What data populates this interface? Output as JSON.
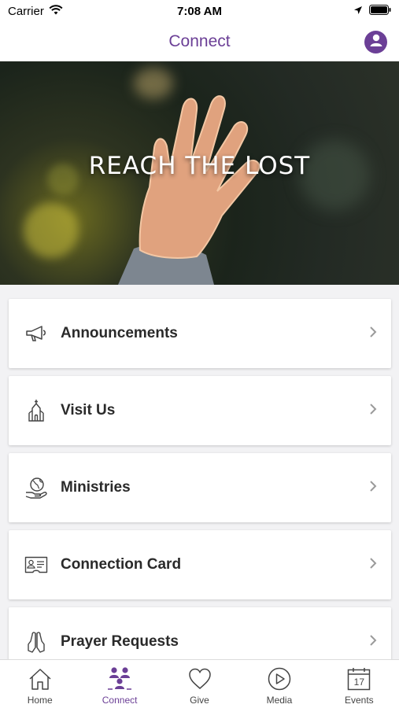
{
  "status_bar": {
    "carrier": "Carrier",
    "time": "7:08 AM"
  },
  "nav": {
    "title": "Connect",
    "profile_icon": "profile-icon"
  },
  "hero": {
    "title": "REACH THE LOST"
  },
  "menu": [
    {
      "label": "Announcements",
      "icon": "megaphone-icon"
    },
    {
      "label": "Visit Us",
      "icon": "church-icon"
    },
    {
      "label": "Ministries",
      "icon": "globe-hand-icon"
    },
    {
      "label": "Connection Card",
      "icon": "id-card-icon"
    },
    {
      "label": "Prayer Requests",
      "icon": "praying-hands-icon"
    }
  ],
  "tabs": [
    {
      "label": "Home",
      "icon": "home-icon",
      "active": false
    },
    {
      "label": "Connect",
      "icon": "people-icon",
      "active": true
    },
    {
      "label": "Give",
      "icon": "heart-icon",
      "active": false
    },
    {
      "label": "Media",
      "icon": "play-icon",
      "active": false
    },
    {
      "label": "Events",
      "icon": "calendar-icon",
      "active": false,
      "calendar_day": "17"
    }
  ],
  "colors": {
    "accent": "#6b3f96",
    "background": "#f2f2f4"
  }
}
